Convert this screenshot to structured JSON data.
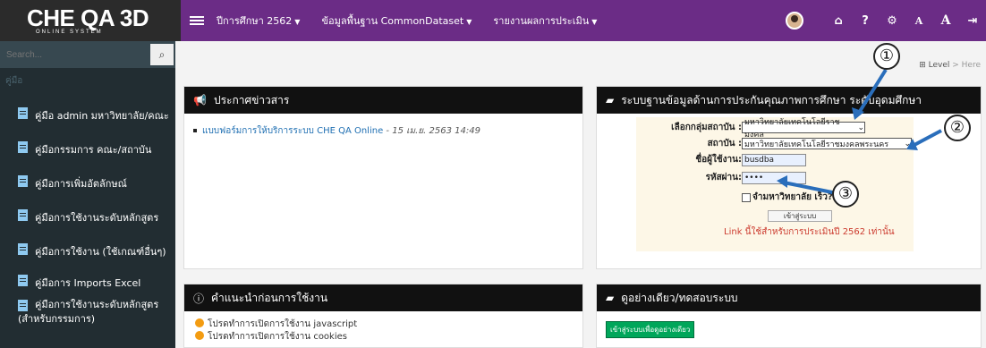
{
  "header": {
    "logo_main": "CHE QA 3D",
    "logo_sub": "ONLINE SYSTEM",
    "menu": [
      {
        "label": "ปีการศึกษา 2562"
      },
      {
        "label": "ข้อมูลพื้นฐาน CommonDataset"
      },
      {
        "label": "รายงานผลการประเมิน"
      }
    ],
    "font_small": "A",
    "font_large": "A"
  },
  "sidebar": {
    "search_placeholder": "Search...",
    "section": "คู่มือ",
    "items": [
      {
        "label": "คู่มือ admin มหาวิทยาลัย/คณะ"
      },
      {
        "label": "คู่มือกรรมการ คณะ/สถาบัน"
      },
      {
        "label": "คู่มือการเพิ่มอัตลักษณ์"
      },
      {
        "label": "คู่มือการใช้งานระดับหลักสูตร"
      },
      {
        "label": "คู่มือการใช้งาน (ใช้เกณฑ์อื่นๆ)"
      },
      {
        "label": "คู่มือการ Imports Excel"
      },
      {
        "label_line1": "คู่มือการใช้งานระดับหลักสูตร",
        "label_line2": "(สำหรับกรรมการ)"
      }
    ]
  },
  "breadcrumb": {
    "level": "Level",
    "here": "Here"
  },
  "news": {
    "title": "ประกาศข่าวสาร",
    "item_link": "แบบฟอร์มการให้บริการระบบ CHE QA Online",
    "item_date": "- 15 เม.ย. 2563 14:49"
  },
  "login": {
    "title": "ระบบฐานข้อมูลด้านการประกันคุณภาพการศึกษา ระดับอุดมศึกษา",
    "group_label": "เลือกกลุ่มสถาบัน :",
    "group_value": "มหาวิทยาลัยเทคโนโลยีราชมงคล",
    "institution_label": "สถาบัน :",
    "institution_value": "มหาวิทยาลัยเทคโนโลยีราชมงคลพระนคร",
    "username_label": "ชื่อผู้ใช้งาน:",
    "username_value": "busdba",
    "password_label": "รหัสผ่าน:",
    "password_value": "••••",
    "remember_label": "จำมหาวิทยาลัย เร็ว?",
    "login_button": "เข้าสู่ระบบ",
    "note": "Link นี้ใช้สำหรับการประเมินปี 2562 เท่านั้น"
  },
  "tips": {
    "title": "คำแนะนำก่อนการใช้งาน",
    "items": [
      "โปรดทำการเปิดการใช้งาน javascript",
      "โปรดทำการเปิดการใช้งาน cookies"
    ]
  },
  "demo": {
    "title": "ดูอย่างเดียว/ทดสอบระบบ",
    "button": "เข้าสู่ระบบเพื่อดูอย่างเดียว"
  },
  "annotations": [
    "①",
    "②",
    "③"
  ],
  "colors": {
    "topbar": "#6b2c86",
    "sidebar": "#222d32",
    "panel_head": "#111111",
    "note": "#cc3b2f",
    "demo_button": "#00a65a"
  }
}
